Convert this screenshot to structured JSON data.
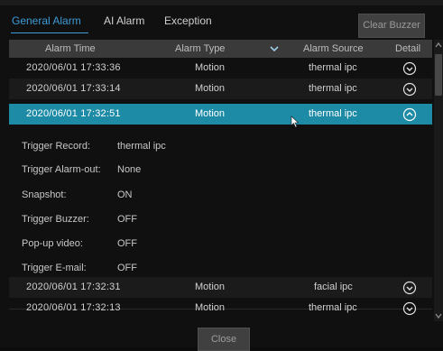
{
  "tabs": [
    {
      "label": "General Alarm",
      "active": true
    },
    {
      "label": "AI Alarm",
      "active": false
    },
    {
      "label": "Exception",
      "active": false
    }
  ],
  "toolbar": {
    "clear_buzzer_label": "Clear Buzzer"
  },
  "table": {
    "headers": {
      "time": "Alarm Time",
      "type": "Alarm Type",
      "source": "Alarm Source",
      "detail": "Detail"
    },
    "rows": [
      {
        "time": "2020/06/01 17:33:36",
        "type": "Motion",
        "source": "thermal ipc",
        "expanded": false
      },
      {
        "time": "2020/06/01 17:33:14",
        "type": "Motion",
        "source": "thermal ipc",
        "expanded": false
      },
      {
        "time": "2020/06/01 17:32:51",
        "type": "Motion",
        "source": "thermal ipc",
        "expanded": true
      },
      {
        "time": "2020/06/01 17:32:31",
        "type": "Motion",
        "source": "facial ipc",
        "expanded": false
      },
      {
        "time": "2020/06/01 17:32:13",
        "type": "Motion",
        "source": "thermal ipc",
        "expanded": false
      }
    ]
  },
  "detail": {
    "items": [
      {
        "label": "Trigger Record:",
        "value": "thermal ipc"
      },
      {
        "label": "Trigger Alarm-out:",
        "value": "None"
      },
      {
        "label": "Snapshot:",
        "value": "ON"
      },
      {
        "label": "Trigger Buzzer:",
        "value": "OFF"
      },
      {
        "label": "Pop-up video:",
        "value": "OFF"
      },
      {
        "label": "Trigger E-mail:",
        "value": "OFF"
      }
    ]
  },
  "footer": {
    "close_label": "Close"
  },
  "icons": {
    "expand": "chevron-down-circle-icon",
    "collapse": "chevron-up-circle-icon",
    "filter": "chevron-down-icon",
    "scroll_up": "scroll-up-arrow-icon",
    "scroll_down": "scroll-down-arrow-icon",
    "cursor": "mouse-pointer-icon"
  },
  "colors": {
    "accent": "#3d9bd6",
    "selected_row": "#1e8ba6",
    "background": "#101010"
  }
}
